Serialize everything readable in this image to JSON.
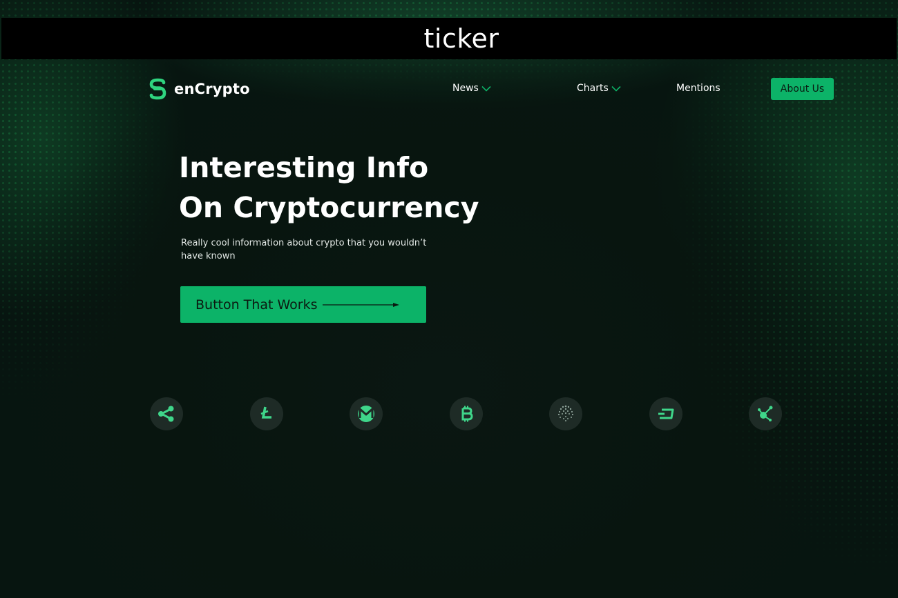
{
  "ticker": {
    "text": "ticker"
  },
  "brand": {
    "name": "enCrypto",
    "logo_icon": "encrypto-logo-icon"
  },
  "nav": {
    "items": [
      {
        "label": "News",
        "has_dropdown": true,
        "icon": "chevron-down-icon"
      },
      {
        "label": "Charts",
        "has_dropdown": true,
        "icon": "chevron-down-icon"
      },
      {
        "label": "Mentions",
        "has_dropdown": false
      }
    ],
    "about_label": "About Us"
  },
  "hero": {
    "title_line1": "Interesting Info",
    "title_line2": "On Cryptocurrency",
    "subtitle": "Really cool information about crypto that you wouldn’t have known",
    "cta_label": "Button That Works",
    "cta_icon": "arrow-right-icon"
  },
  "coins": [
    {
      "icon": "ripple-icon"
    },
    {
      "icon": "litecoin-icon"
    },
    {
      "icon": "monero-icon"
    },
    {
      "icon": "bitcoin-icon"
    },
    {
      "icon": "iota-icon"
    },
    {
      "icon": "dash-icon"
    },
    {
      "icon": "network-icon"
    }
  ],
  "colors": {
    "accent": "#0cb368",
    "icon_green": "#3fd68a",
    "background": "#071510",
    "coin_circle": "#1e2b26",
    "ticker_bar": "#000000"
  }
}
